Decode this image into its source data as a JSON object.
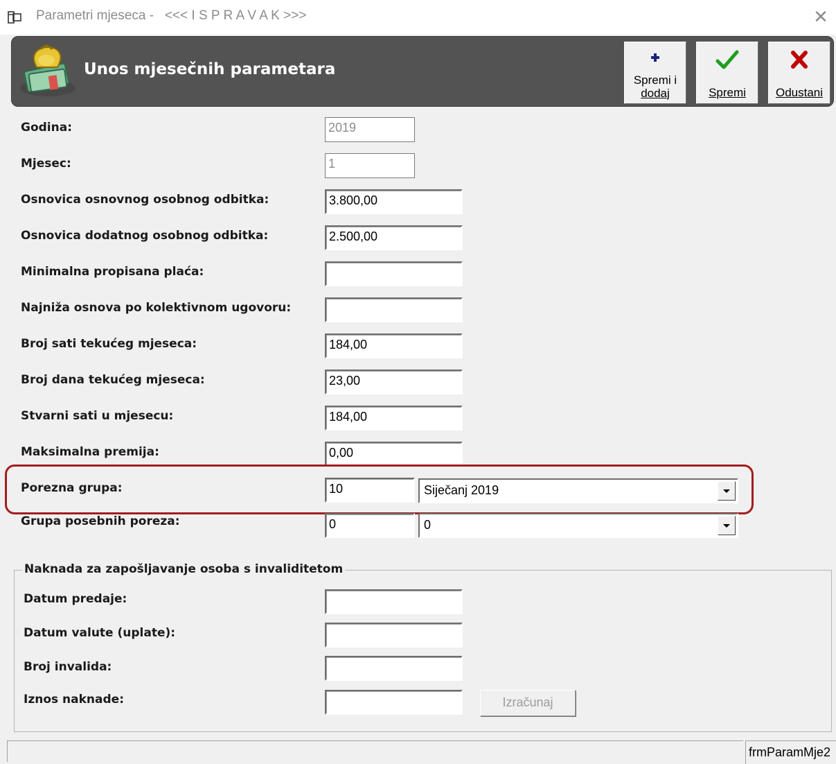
{
  "window": {
    "title": "Parametri mjeseca -   <<< I S P R A V A K >>>",
    "close_glyph": "✕",
    "icon": "app-window-icon"
  },
  "header": {
    "title": "Unos mjesečnih parametara",
    "logo_icon": "money-bag-icon",
    "buttons": {
      "save_add": {
        "line1": "Spremi i",
        "line2": "dodaj",
        "icon": "plus-icon"
      },
      "save": {
        "label": "Spremi",
        "icon": "checkmark-icon"
      },
      "cancel": {
        "label": "Odustani",
        "icon": "x-icon"
      }
    }
  },
  "fields": {
    "godina": {
      "label": "Godina:",
      "value": "2019"
    },
    "mjesec": {
      "label": "Mjesec:",
      "value": "1"
    },
    "osnovni_odbitak": {
      "label": "Osnovica osnovnog osobnog odbitka:",
      "value": "3.800,00"
    },
    "dodatni_odbitak": {
      "label": "Osnovica dodatnog osobnog odbitka:",
      "value": "2.500,00"
    },
    "min_placa": {
      "label": "Minimalna propisana plaća:",
      "value": ""
    },
    "najniza_osnova": {
      "label": "Najniža osnova po kolektivnom ugovoru:",
      "value": ""
    },
    "broj_sati": {
      "label": "Broj sati tekućeg mjeseca:",
      "value": "184,00"
    },
    "broj_dana": {
      "label": "Broj dana tekućeg mjeseca:",
      "value": "23,00"
    },
    "stvarni_sati": {
      "label": "Stvarni sati u mjesecu:",
      "value": "184,00"
    },
    "max_premija": {
      "label": "Maksimalna premija:",
      "value": "0,00"
    },
    "porezna_grupa": {
      "label": "Porezna grupa:",
      "code": "10",
      "selected": "Siječanj 2019"
    },
    "posebni_porez": {
      "label": "Grupa posebnih poreza:",
      "code": "0",
      "selected": "0"
    }
  },
  "invalid_group": {
    "legend": "Naknada za zapošljavanje osoba s invaliditetom",
    "datum_predaje": {
      "label": "Datum predaje:",
      "value": ""
    },
    "datum_valute": {
      "label": "Datum valute (uplate):",
      "value": ""
    },
    "broj_invalida": {
      "label": "Broj invalida:",
      "value": ""
    },
    "iznos_naknade": {
      "label": "Iznos naknade:",
      "value": ""
    },
    "calc_button": "Izračunaj"
  },
  "status": {
    "form_name": "frmParamMje2"
  },
  "colors": {
    "header_bg": "#535353",
    "highlight": "#a31d1d",
    "save_check": "#1e9e1e",
    "cancel_x": "#c00000"
  }
}
